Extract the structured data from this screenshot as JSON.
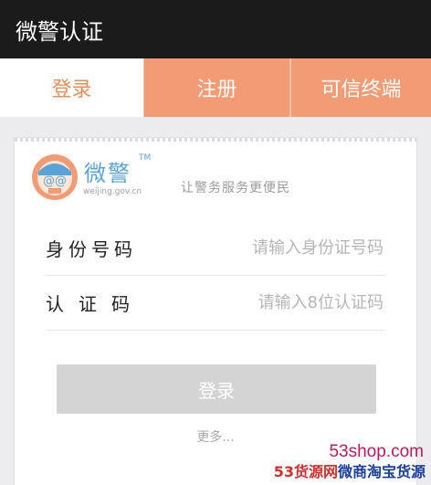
{
  "window": {
    "title": "微警认证"
  },
  "tabs": [
    {
      "label": "登录",
      "active": true
    },
    {
      "label": "注册",
      "active": false
    },
    {
      "label": "可信终端",
      "active": false
    }
  ],
  "brand": {
    "name": "微警",
    "tm": "TM",
    "domain": "weijing.gov.cn",
    "slogan": "让警务服务更便民"
  },
  "form": {
    "id_label": "身份号码",
    "id_placeholder": "请输入身份证号码",
    "id_value": "",
    "code_label": "认证码",
    "code_placeholder": "请输入8位认证码",
    "code_value": "",
    "submit_label": "登录",
    "more_label": "更多..."
  },
  "watermark": {
    "line1": "53shop.com",
    "line2_part1": "53货源网",
    "line2_part2": "微商淘宝货源"
  },
  "colors": {
    "accent": "#f39b74",
    "active_tab_text": "#e98e5a",
    "logo_blue": "#5aa3d7",
    "button_disabled": "#d4d4d4"
  },
  "icons": [
    "police-logo-icon"
  ]
}
